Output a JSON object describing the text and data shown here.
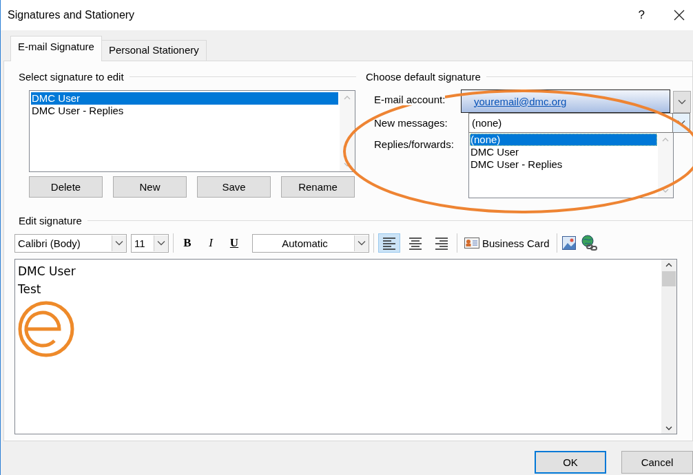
{
  "window": {
    "title": "Signatures and Stationery",
    "help": "?"
  },
  "tabs": [
    {
      "label": "E-mail Signature",
      "selected": true
    },
    {
      "label": "Personal Stationery",
      "selected": false
    }
  ],
  "select_signature": {
    "title": "Select signature to edit",
    "items": [
      {
        "label": "DMC User",
        "selected": true
      },
      {
        "label": "DMC User - Replies",
        "selected": false
      }
    ],
    "buttons": [
      "Delete",
      "New",
      "Save",
      "Rename"
    ]
  },
  "default_signature": {
    "title": "Choose default signature",
    "email_account": {
      "label": "E-mail account:",
      "value": "youremail@dmc.org"
    },
    "new_messages": {
      "label": "New messages:",
      "value": "(none)"
    },
    "replies_forwards": {
      "label": "Replies/forwards:",
      "options": [
        {
          "label": "(none)",
          "selected": true
        },
        {
          "label": "DMC User",
          "selected": false
        },
        {
          "label": "DMC User - Replies",
          "selected": false
        }
      ]
    }
  },
  "edit_signature": {
    "title": "Edit signature",
    "font": "Calibri (Body)",
    "size": "11",
    "format_buttons": [
      "B",
      "I",
      "U"
    ],
    "font_color": "Automatic",
    "alignment_buttons": [
      {
        "selected": true
      },
      {
        "selected": false
      },
      {
        "selected": false
      }
    ],
    "business_card": "Business Card",
    "lines": [
      "DMC User",
      "Test"
    ]
  },
  "buttons": [
    {
      "label": "OK",
      "default": true
    },
    {
      "label": "Cancel",
      "default": false
    }
  ]
}
